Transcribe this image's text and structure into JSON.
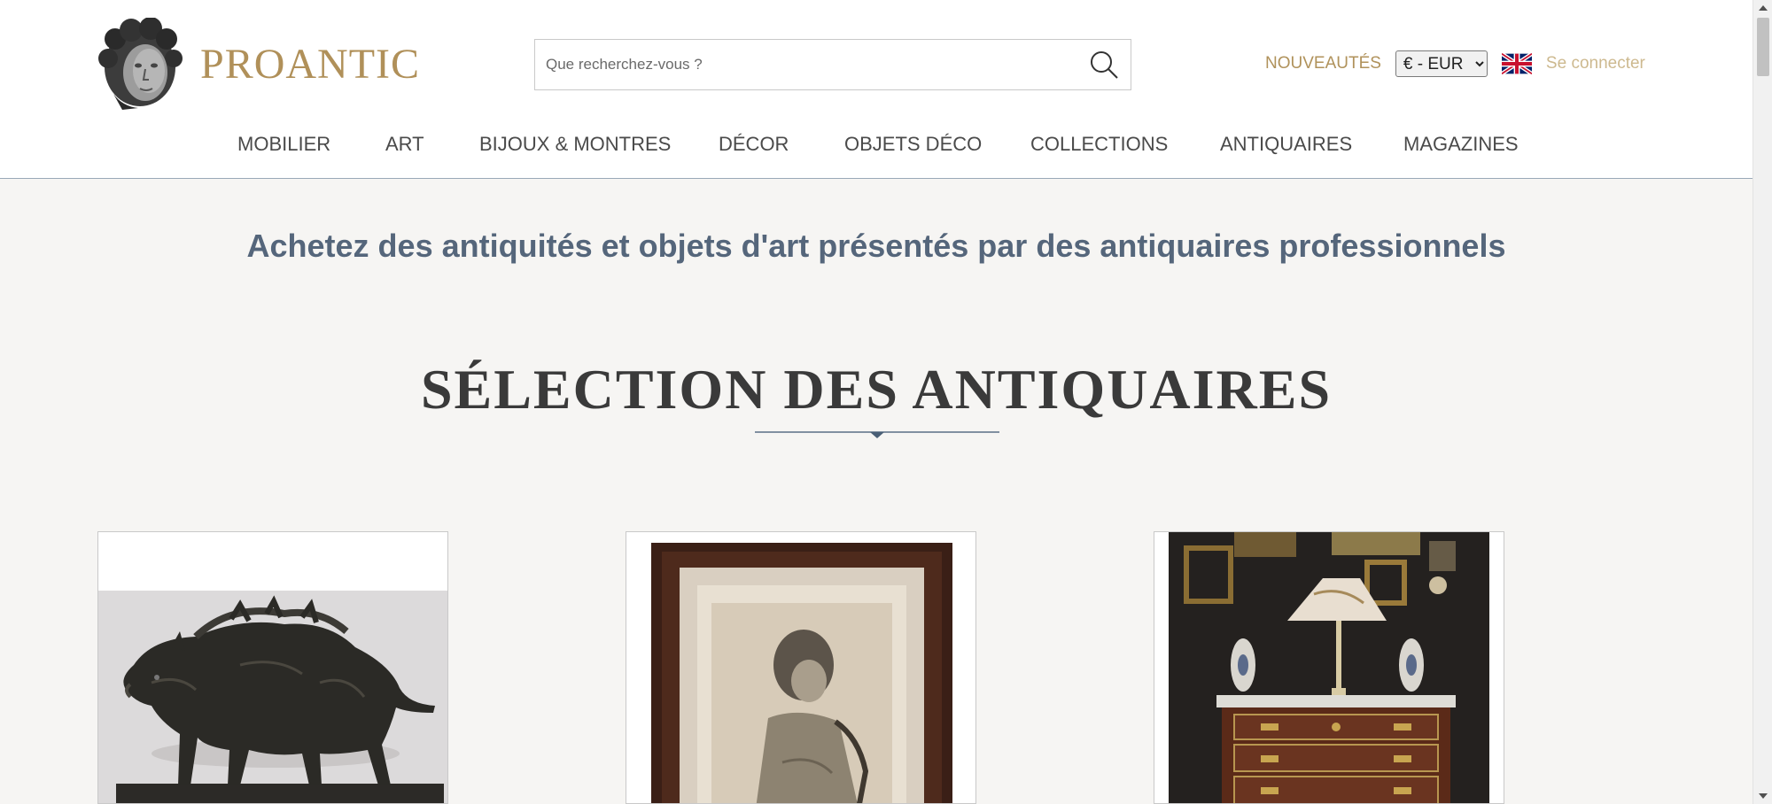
{
  "brand": {
    "name": "PROANTIC",
    "color": "#b09059"
  },
  "search": {
    "placeholder": "Que recherchez-vous ?"
  },
  "topnav": {
    "new_label": "NOUVEAUTÉS",
    "currency": {
      "selected": "€ - EUR",
      "options": [
        "€ - EUR"
      ]
    },
    "language_icon": "uk-flag-icon",
    "login_label": "Se connecter"
  },
  "mainnav": {
    "items": [
      {
        "label": "MOBILIER"
      },
      {
        "label": "ART"
      },
      {
        "label": "BIJOUX & MONTRES"
      },
      {
        "label": "DÉCOR"
      },
      {
        "label": "OBJETS DÉCO"
      },
      {
        "label": "COLLECTIONS"
      },
      {
        "label": "ANTIQUAIRES"
      },
      {
        "label": "MAGAZINES"
      }
    ]
  },
  "content": {
    "tagline": "Achetez des antiquités et objets d'art présentés par des antiquaires professionnels",
    "section_title": "SÉLECTION DES ANTIQUAIRES"
  },
  "colors": {
    "accent_gold": "#b0925b",
    "tagline_blue": "#55667b",
    "background": "#f6f5f3"
  }
}
